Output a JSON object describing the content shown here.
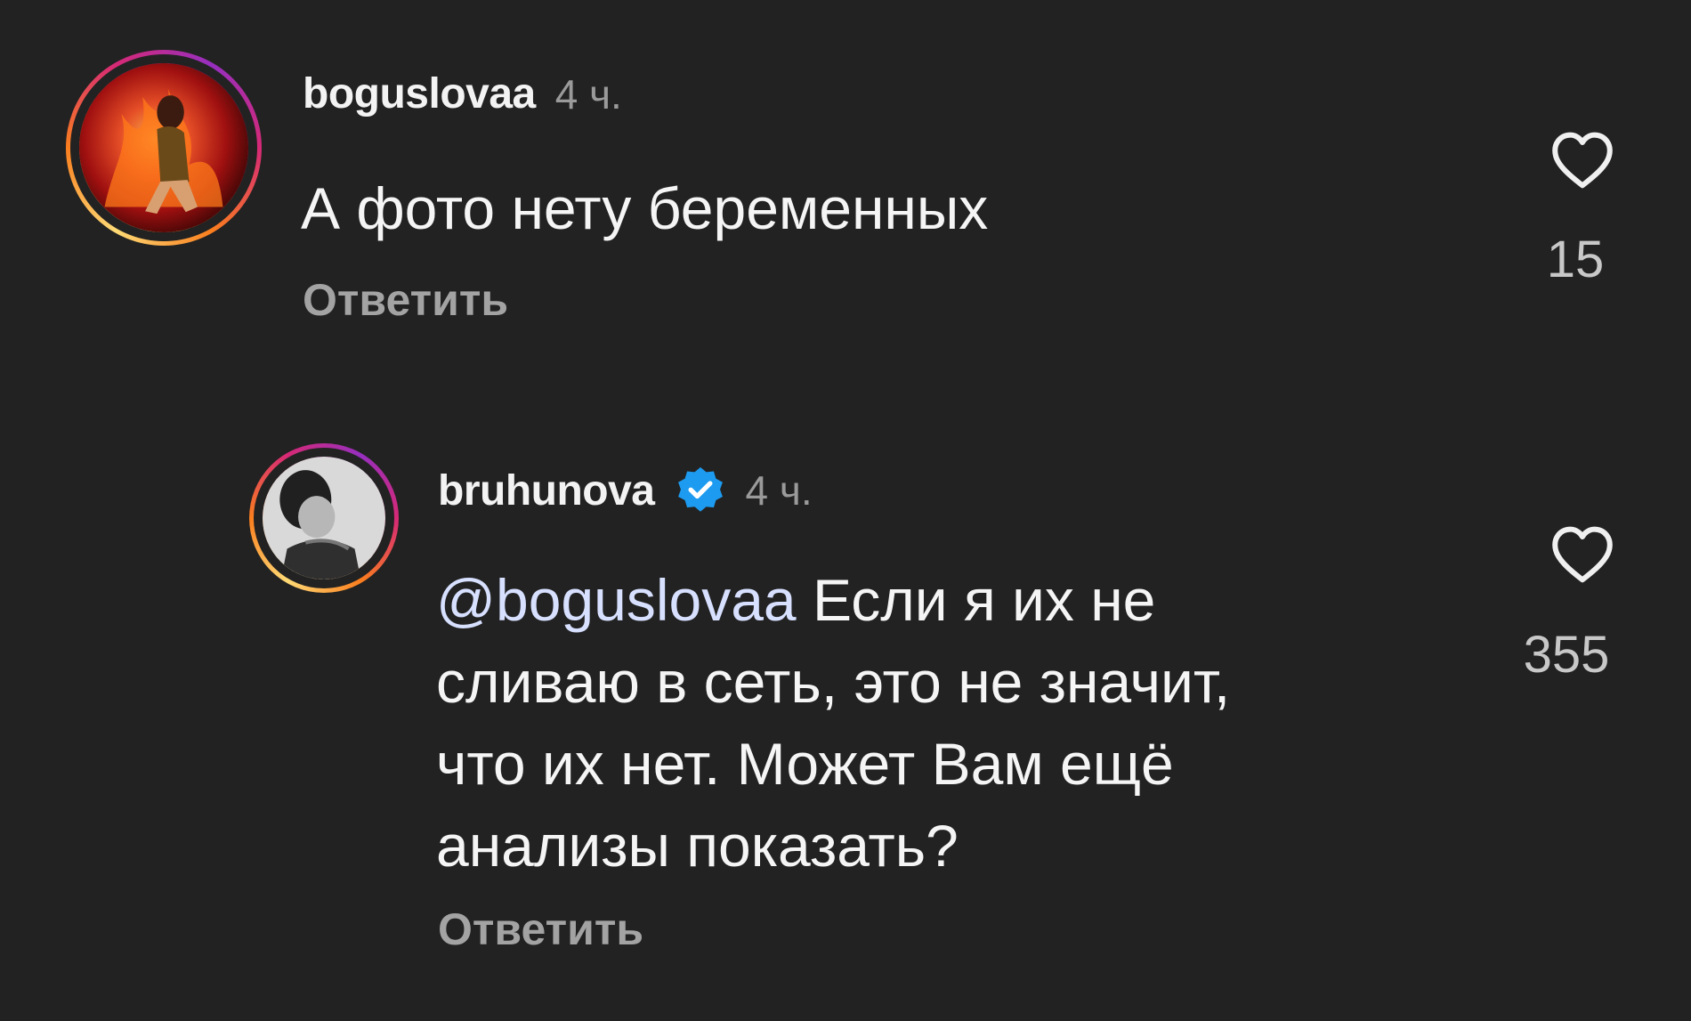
{
  "colors": {
    "background": "#222222",
    "text_primary": "#f5f5f5",
    "text_secondary": "#9a9a9a",
    "verified_badge": "#1d9bf0",
    "story_ring": [
      "#feda75",
      "#fa7e1e",
      "#d62976",
      "#962fbf"
    ]
  },
  "comments": [
    {
      "username": "boguslovaa",
      "time": "4 ч.",
      "text": "А фото нету беременных",
      "reply_label": "Ответить",
      "likes": "15",
      "avatar_icon": "user-avatar",
      "like_icon": "heart-icon"
    },
    {
      "username": "bruhunova",
      "verified": true,
      "verified_icon": "verified-badge-icon",
      "time": "4 ч.",
      "mention": "@boguslovaa",
      "text": " Если я их не\nсливаю в сеть, это не значит,\nчто их нет. Может Вам ещё\nанализы показать?",
      "reply_label": "Ответить",
      "likes": "355",
      "avatar_icon": "user-avatar",
      "like_icon": "heart-icon"
    }
  ]
}
